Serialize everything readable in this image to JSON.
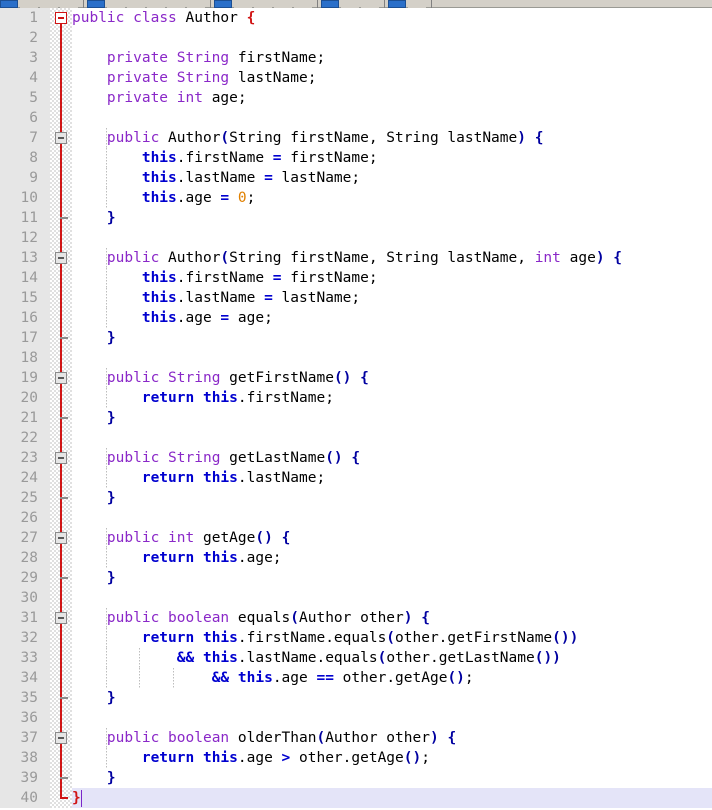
{
  "app": {
    "type": "code-editor",
    "language": "Java",
    "file_class": "Author",
    "total_lines": 40,
    "current_line": 40
  },
  "toolbar": {
    "groups": [
      {
        "buttons": [
          "blue",
          "plain",
          "plain",
          "plain"
        ]
      },
      {
        "buttons": [
          "blue",
          "plain",
          "plain",
          "plain",
          "plain",
          "plain"
        ]
      },
      {
        "buttons": [
          "blue",
          "plain",
          "plain",
          "plain",
          "plain"
        ]
      },
      {
        "buttons": [
          "blue",
          "plain",
          "plain"
        ]
      },
      {
        "buttons": [
          "blue",
          "plain"
        ]
      }
    ]
  },
  "colors": {
    "keyword": "#8a28c8",
    "this_return": "#0000cf",
    "bracket": "#0000a0",
    "brace_red": "#d01414",
    "number": "#e08000",
    "identifier": "#000000",
    "gutter_bg": "#e6e6e6",
    "gutter_text": "#9a9a9a",
    "current_line_bg": "#e4e4f8",
    "editor_bg": "#ffffff",
    "fold_line": "#d01414",
    "caret": "#7a26c9"
  },
  "editor": {
    "lines": [
      {
        "n": 1,
        "fold": "box-red",
        "foldline": "half-top",
        "indent": 0,
        "tokens": [
          {
            "t": "public",
            "c": "kw"
          },
          {
            "t": " ",
            "c": "id"
          },
          {
            "t": "class",
            "c": "kw"
          },
          {
            "t": " Author ",
            "c": "id"
          },
          {
            "t": "{",
            "c": "brace-red"
          }
        ]
      },
      {
        "n": 2,
        "fold": "none",
        "foldline": "full",
        "indent": 0,
        "tokens": []
      },
      {
        "n": 3,
        "fold": "none",
        "foldline": "full",
        "indent": 0,
        "tokens": [
          {
            "t": "    ",
            "c": "id"
          },
          {
            "t": "private",
            "c": "kw"
          },
          {
            "t": " ",
            "c": "id"
          },
          {
            "t": "String",
            "c": "kw"
          },
          {
            "t": " firstName;",
            "c": "id"
          }
        ]
      },
      {
        "n": 4,
        "fold": "none",
        "foldline": "full",
        "indent": 0,
        "tokens": [
          {
            "t": "    ",
            "c": "id"
          },
          {
            "t": "private",
            "c": "kw"
          },
          {
            "t": " ",
            "c": "id"
          },
          {
            "t": "String",
            "c": "kw"
          },
          {
            "t": " lastName;",
            "c": "id"
          }
        ]
      },
      {
        "n": 5,
        "fold": "none",
        "foldline": "full",
        "indent": 0,
        "tokens": [
          {
            "t": "    ",
            "c": "id"
          },
          {
            "t": "private",
            "c": "kw"
          },
          {
            "t": " ",
            "c": "id"
          },
          {
            "t": "int",
            "c": "kw"
          },
          {
            "t": " age;",
            "c": "id"
          }
        ]
      },
      {
        "n": 6,
        "fold": "none",
        "foldline": "full",
        "indent": 0,
        "tokens": []
      },
      {
        "n": 7,
        "fold": "box-gray",
        "foldline": "full",
        "indent": 1,
        "tokens": [
          {
            "t": "    ",
            "c": "id"
          },
          {
            "t": "public",
            "c": "kw"
          },
          {
            "t": " Author",
            "c": "id"
          },
          {
            "t": "(",
            "c": "br"
          },
          {
            "t": "String firstName, String lastName",
            "c": "id"
          },
          {
            "t": ")",
            "c": "br"
          },
          {
            "t": " ",
            "c": "id"
          },
          {
            "t": "{",
            "c": "br"
          }
        ]
      },
      {
        "n": 8,
        "fold": "none",
        "foldline": "full",
        "indent": 1,
        "tokens": [
          {
            "t": "        ",
            "c": "id"
          },
          {
            "t": "this",
            "c": "this"
          },
          {
            "t": ".firstName ",
            "c": "id"
          },
          {
            "t": "=",
            "c": "this"
          },
          {
            "t": " firstName;",
            "c": "id"
          }
        ]
      },
      {
        "n": 9,
        "fold": "none",
        "foldline": "full",
        "indent": 1,
        "tokens": [
          {
            "t": "        ",
            "c": "id"
          },
          {
            "t": "this",
            "c": "this"
          },
          {
            "t": ".lastName ",
            "c": "id"
          },
          {
            "t": "=",
            "c": "this"
          },
          {
            "t": " lastName;",
            "c": "id"
          }
        ]
      },
      {
        "n": 10,
        "fold": "none",
        "foldline": "full",
        "indent": 1,
        "tokens": [
          {
            "t": "        ",
            "c": "id"
          },
          {
            "t": "this",
            "c": "this"
          },
          {
            "t": ".age ",
            "c": "id"
          },
          {
            "t": "=",
            "c": "this"
          },
          {
            "t": " ",
            "c": "id"
          },
          {
            "t": "0",
            "c": "num"
          },
          {
            "t": ";",
            "c": "id"
          }
        ]
      },
      {
        "n": 11,
        "fold": "end-gray",
        "foldline": "full",
        "indent": 0,
        "tokens": [
          {
            "t": "    ",
            "c": "id"
          },
          {
            "t": "}",
            "c": "br"
          }
        ]
      },
      {
        "n": 12,
        "fold": "none",
        "foldline": "full",
        "indent": 0,
        "tokens": []
      },
      {
        "n": 13,
        "fold": "box-gray",
        "foldline": "full",
        "indent": 1,
        "tokens": [
          {
            "t": "    ",
            "c": "id"
          },
          {
            "t": "public",
            "c": "kw"
          },
          {
            "t": " Author",
            "c": "id"
          },
          {
            "t": "(",
            "c": "br"
          },
          {
            "t": "String firstName, String lastName, ",
            "c": "id"
          },
          {
            "t": "int",
            "c": "kw"
          },
          {
            "t": " age",
            "c": "id"
          },
          {
            "t": ")",
            "c": "br"
          },
          {
            "t": " ",
            "c": "id"
          },
          {
            "t": "{",
            "c": "br"
          }
        ]
      },
      {
        "n": 14,
        "fold": "none",
        "foldline": "full",
        "indent": 1,
        "tokens": [
          {
            "t": "        ",
            "c": "id"
          },
          {
            "t": "this",
            "c": "this"
          },
          {
            "t": ".firstName ",
            "c": "id"
          },
          {
            "t": "=",
            "c": "this"
          },
          {
            "t": " firstName;",
            "c": "id"
          }
        ]
      },
      {
        "n": 15,
        "fold": "none",
        "foldline": "full",
        "indent": 1,
        "tokens": [
          {
            "t": "        ",
            "c": "id"
          },
          {
            "t": "this",
            "c": "this"
          },
          {
            "t": ".lastName ",
            "c": "id"
          },
          {
            "t": "=",
            "c": "this"
          },
          {
            "t": " lastName;",
            "c": "id"
          }
        ]
      },
      {
        "n": 16,
        "fold": "none",
        "foldline": "full",
        "indent": 1,
        "tokens": [
          {
            "t": "        ",
            "c": "id"
          },
          {
            "t": "this",
            "c": "this"
          },
          {
            "t": ".age ",
            "c": "id"
          },
          {
            "t": "=",
            "c": "this"
          },
          {
            "t": " age;",
            "c": "id"
          }
        ]
      },
      {
        "n": 17,
        "fold": "end-gray",
        "foldline": "full",
        "indent": 0,
        "tokens": [
          {
            "t": "    ",
            "c": "id"
          },
          {
            "t": "}",
            "c": "br"
          }
        ]
      },
      {
        "n": 18,
        "fold": "none",
        "foldline": "full",
        "indent": 0,
        "tokens": []
      },
      {
        "n": 19,
        "fold": "box-gray",
        "foldline": "full",
        "indent": 1,
        "tokens": [
          {
            "t": "    ",
            "c": "id"
          },
          {
            "t": "public",
            "c": "kw"
          },
          {
            "t": " ",
            "c": "id"
          },
          {
            "t": "String",
            "c": "kw"
          },
          {
            "t": " getFirstName",
            "c": "id"
          },
          {
            "t": "()",
            "c": "br"
          },
          {
            "t": " ",
            "c": "id"
          },
          {
            "t": "{",
            "c": "br"
          }
        ]
      },
      {
        "n": 20,
        "fold": "none",
        "foldline": "full",
        "indent": 1,
        "tokens": [
          {
            "t": "        ",
            "c": "id"
          },
          {
            "t": "return",
            "c": "this"
          },
          {
            "t": " ",
            "c": "id"
          },
          {
            "t": "this",
            "c": "this"
          },
          {
            "t": ".firstName;",
            "c": "id"
          }
        ]
      },
      {
        "n": 21,
        "fold": "end-gray",
        "foldline": "full",
        "indent": 0,
        "tokens": [
          {
            "t": "    ",
            "c": "id"
          },
          {
            "t": "}",
            "c": "br"
          }
        ]
      },
      {
        "n": 22,
        "fold": "none",
        "foldline": "full",
        "indent": 0,
        "tokens": []
      },
      {
        "n": 23,
        "fold": "box-gray",
        "foldline": "full",
        "indent": 1,
        "tokens": [
          {
            "t": "    ",
            "c": "id"
          },
          {
            "t": "public",
            "c": "kw"
          },
          {
            "t": " ",
            "c": "id"
          },
          {
            "t": "String",
            "c": "kw"
          },
          {
            "t": " getLastName",
            "c": "id"
          },
          {
            "t": "()",
            "c": "br"
          },
          {
            "t": " ",
            "c": "id"
          },
          {
            "t": "{",
            "c": "br"
          }
        ]
      },
      {
        "n": 24,
        "fold": "none",
        "foldline": "full",
        "indent": 1,
        "tokens": [
          {
            "t": "        ",
            "c": "id"
          },
          {
            "t": "return",
            "c": "this"
          },
          {
            "t": " ",
            "c": "id"
          },
          {
            "t": "this",
            "c": "this"
          },
          {
            "t": ".lastName;",
            "c": "id"
          }
        ]
      },
      {
        "n": 25,
        "fold": "end-gray",
        "foldline": "full",
        "indent": 0,
        "tokens": [
          {
            "t": "    ",
            "c": "id"
          },
          {
            "t": "}",
            "c": "br"
          }
        ]
      },
      {
        "n": 26,
        "fold": "none",
        "foldline": "full",
        "indent": 0,
        "tokens": []
      },
      {
        "n": 27,
        "fold": "box-gray",
        "foldline": "full",
        "indent": 1,
        "tokens": [
          {
            "t": "    ",
            "c": "id"
          },
          {
            "t": "public",
            "c": "kw"
          },
          {
            "t": " ",
            "c": "id"
          },
          {
            "t": "int",
            "c": "kw"
          },
          {
            "t": " getAge",
            "c": "id"
          },
          {
            "t": "()",
            "c": "br"
          },
          {
            "t": " ",
            "c": "id"
          },
          {
            "t": "{",
            "c": "br"
          }
        ]
      },
      {
        "n": 28,
        "fold": "none",
        "foldline": "full",
        "indent": 1,
        "tokens": [
          {
            "t": "        ",
            "c": "id"
          },
          {
            "t": "return",
            "c": "this"
          },
          {
            "t": " ",
            "c": "id"
          },
          {
            "t": "this",
            "c": "this"
          },
          {
            "t": ".age;",
            "c": "id"
          }
        ]
      },
      {
        "n": 29,
        "fold": "end-gray",
        "foldline": "full",
        "indent": 0,
        "tokens": [
          {
            "t": "    ",
            "c": "id"
          },
          {
            "t": "}",
            "c": "br"
          }
        ]
      },
      {
        "n": 30,
        "fold": "none",
        "foldline": "full",
        "indent": 0,
        "tokens": []
      },
      {
        "n": 31,
        "fold": "box-gray",
        "foldline": "full",
        "indent": 1,
        "tokens": [
          {
            "t": "    ",
            "c": "id"
          },
          {
            "t": "public",
            "c": "kw"
          },
          {
            "t": " ",
            "c": "id"
          },
          {
            "t": "boolean",
            "c": "kw"
          },
          {
            "t": " equals",
            "c": "id"
          },
          {
            "t": "(",
            "c": "br"
          },
          {
            "t": "Author other",
            "c": "id"
          },
          {
            "t": ")",
            "c": "br"
          },
          {
            "t": " ",
            "c": "id"
          },
          {
            "t": "{",
            "c": "br"
          }
        ]
      },
      {
        "n": 32,
        "fold": "none",
        "foldline": "full",
        "indent": 1,
        "tokens": [
          {
            "t": "        ",
            "c": "id"
          },
          {
            "t": "return",
            "c": "this"
          },
          {
            "t": " ",
            "c": "id"
          },
          {
            "t": "this",
            "c": "this"
          },
          {
            "t": ".firstName.equals",
            "c": "id"
          },
          {
            "t": "(",
            "c": "br"
          },
          {
            "t": "other.getFirstName",
            "c": "id"
          },
          {
            "t": "())",
            "c": "br"
          }
        ]
      },
      {
        "n": 33,
        "fold": "none",
        "foldline": "full",
        "indent": 2,
        "tokens": [
          {
            "t": "            ",
            "c": "id"
          },
          {
            "t": "&&",
            "c": "this"
          },
          {
            "t": " ",
            "c": "id"
          },
          {
            "t": "this",
            "c": "this"
          },
          {
            "t": ".lastName.equals",
            "c": "id"
          },
          {
            "t": "(",
            "c": "br"
          },
          {
            "t": "other.getLastName",
            "c": "id"
          },
          {
            "t": "())",
            "c": "br"
          }
        ]
      },
      {
        "n": 34,
        "fold": "none",
        "foldline": "full",
        "indent": 3,
        "tokens": [
          {
            "t": "                ",
            "c": "id"
          },
          {
            "t": "&&",
            "c": "this"
          },
          {
            "t": " ",
            "c": "id"
          },
          {
            "t": "this",
            "c": "this"
          },
          {
            "t": ".age ",
            "c": "id"
          },
          {
            "t": "==",
            "c": "this"
          },
          {
            "t": " other.getAge",
            "c": "id"
          },
          {
            "t": "()",
            "c": "br"
          },
          {
            "t": ";",
            "c": "id"
          }
        ]
      },
      {
        "n": 35,
        "fold": "end-gray",
        "foldline": "full",
        "indent": 0,
        "tokens": [
          {
            "t": "    ",
            "c": "id"
          },
          {
            "t": "}",
            "c": "br"
          }
        ]
      },
      {
        "n": 36,
        "fold": "none",
        "foldline": "full",
        "indent": 0,
        "tokens": []
      },
      {
        "n": 37,
        "fold": "box-gray",
        "foldline": "full",
        "indent": 1,
        "tokens": [
          {
            "t": "    ",
            "c": "id"
          },
          {
            "t": "public",
            "c": "kw"
          },
          {
            "t": " ",
            "c": "id"
          },
          {
            "t": "boolean",
            "c": "kw"
          },
          {
            "t": " olderThan",
            "c": "id"
          },
          {
            "t": "(",
            "c": "br"
          },
          {
            "t": "Author other",
            "c": "id"
          },
          {
            "t": ")",
            "c": "br"
          },
          {
            "t": " ",
            "c": "id"
          },
          {
            "t": "{",
            "c": "br"
          }
        ]
      },
      {
        "n": 38,
        "fold": "none",
        "foldline": "full",
        "indent": 1,
        "tokens": [
          {
            "t": "        ",
            "c": "id"
          },
          {
            "t": "return",
            "c": "this"
          },
          {
            "t": " ",
            "c": "id"
          },
          {
            "t": "this",
            "c": "this"
          },
          {
            "t": ".age ",
            "c": "id"
          },
          {
            "t": ">",
            "c": "this"
          },
          {
            "t": " other.getAge",
            "c": "id"
          },
          {
            "t": "()",
            "c": "br"
          },
          {
            "t": ";",
            "c": "id"
          }
        ]
      },
      {
        "n": 39,
        "fold": "end-gray",
        "foldline": "full",
        "indent": 0,
        "tokens": [
          {
            "t": "    ",
            "c": "id"
          },
          {
            "t": "}",
            "c": "br"
          }
        ]
      },
      {
        "n": 40,
        "fold": "end-red",
        "foldline": "half-bot",
        "indent": 0,
        "current": true,
        "caret": true,
        "tokens": [
          {
            "t": "}",
            "c": "brace-red"
          }
        ]
      }
    ]
  }
}
